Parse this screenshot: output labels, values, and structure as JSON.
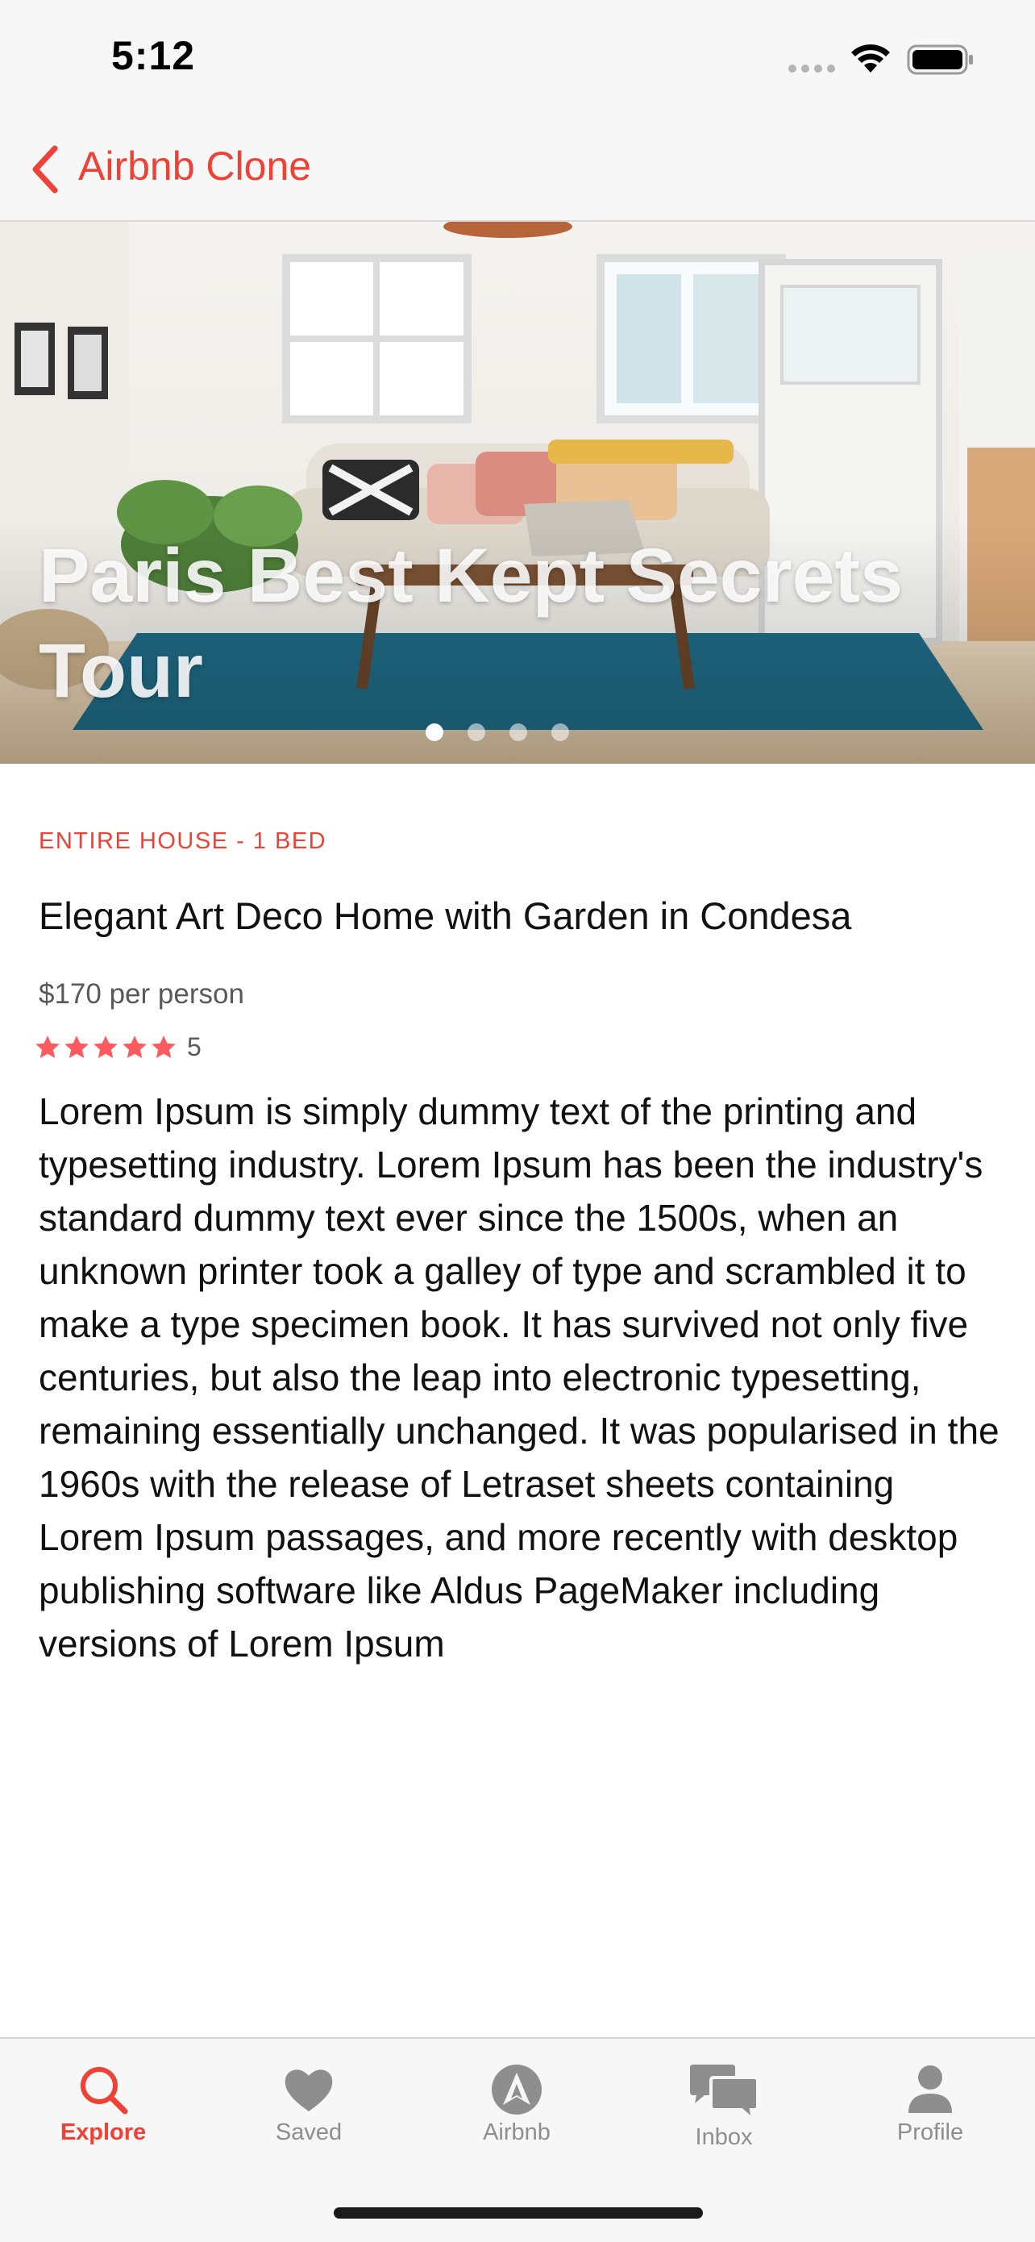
{
  "status_bar": {
    "time": "5:12"
  },
  "nav": {
    "back_label": "Airbnb Clone"
  },
  "hero": {
    "title": "Paris Best Kept Secrets Tour",
    "page_count": 4,
    "active_page": 1
  },
  "listing": {
    "category": "ENTIRE HOUSE - 1 BED",
    "title": "Elegant Art Deco Home with Garden in Condesa",
    "price": "$170 per person",
    "rating_stars": 5,
    "rating_count": "5",
    "description": "Lorem Ipsum is simply dummy text of the printing and typesetting industry. Lorem Ipsum has been the industry's standard dummy text ever since the 1500s, when an unknown printer took a galley of type and scrambled it to make a type specimen book. It has survived not only five centuries, but also the leap into electronic typesetting, remaining essentially unchanged. It was popularised in the 1960s with the release of Letraset sheets containing Lorem Ipsum passages, and more recently with desktop publishing software like Aldus PageMaker including versions of Lorem Ipsum"
  },
  "tabs": [
    {
      "label": "Explore",
      "icon": "search-icon",
      "active": true
    },
    {
      "label": "Saved",
      "icon": "heart-icon",
      "active": false
    },
    {
      "label": "Airbnb",
      "icon": "airbnb-logo-icon",
      "active": false
    },
    {
      "label": "Inbox",
      "icon": "chat-bubbles-icon",
      "active": false
    },
    {
      "label": "Profile",
      "icon": "person-icon",
      "active": false
    }
  ],
  "colors": {
    "accent": "#ef4135",
    "star": "#ff5a5f",
    "tab_inactive": "#8e8e8e"
  }
}
